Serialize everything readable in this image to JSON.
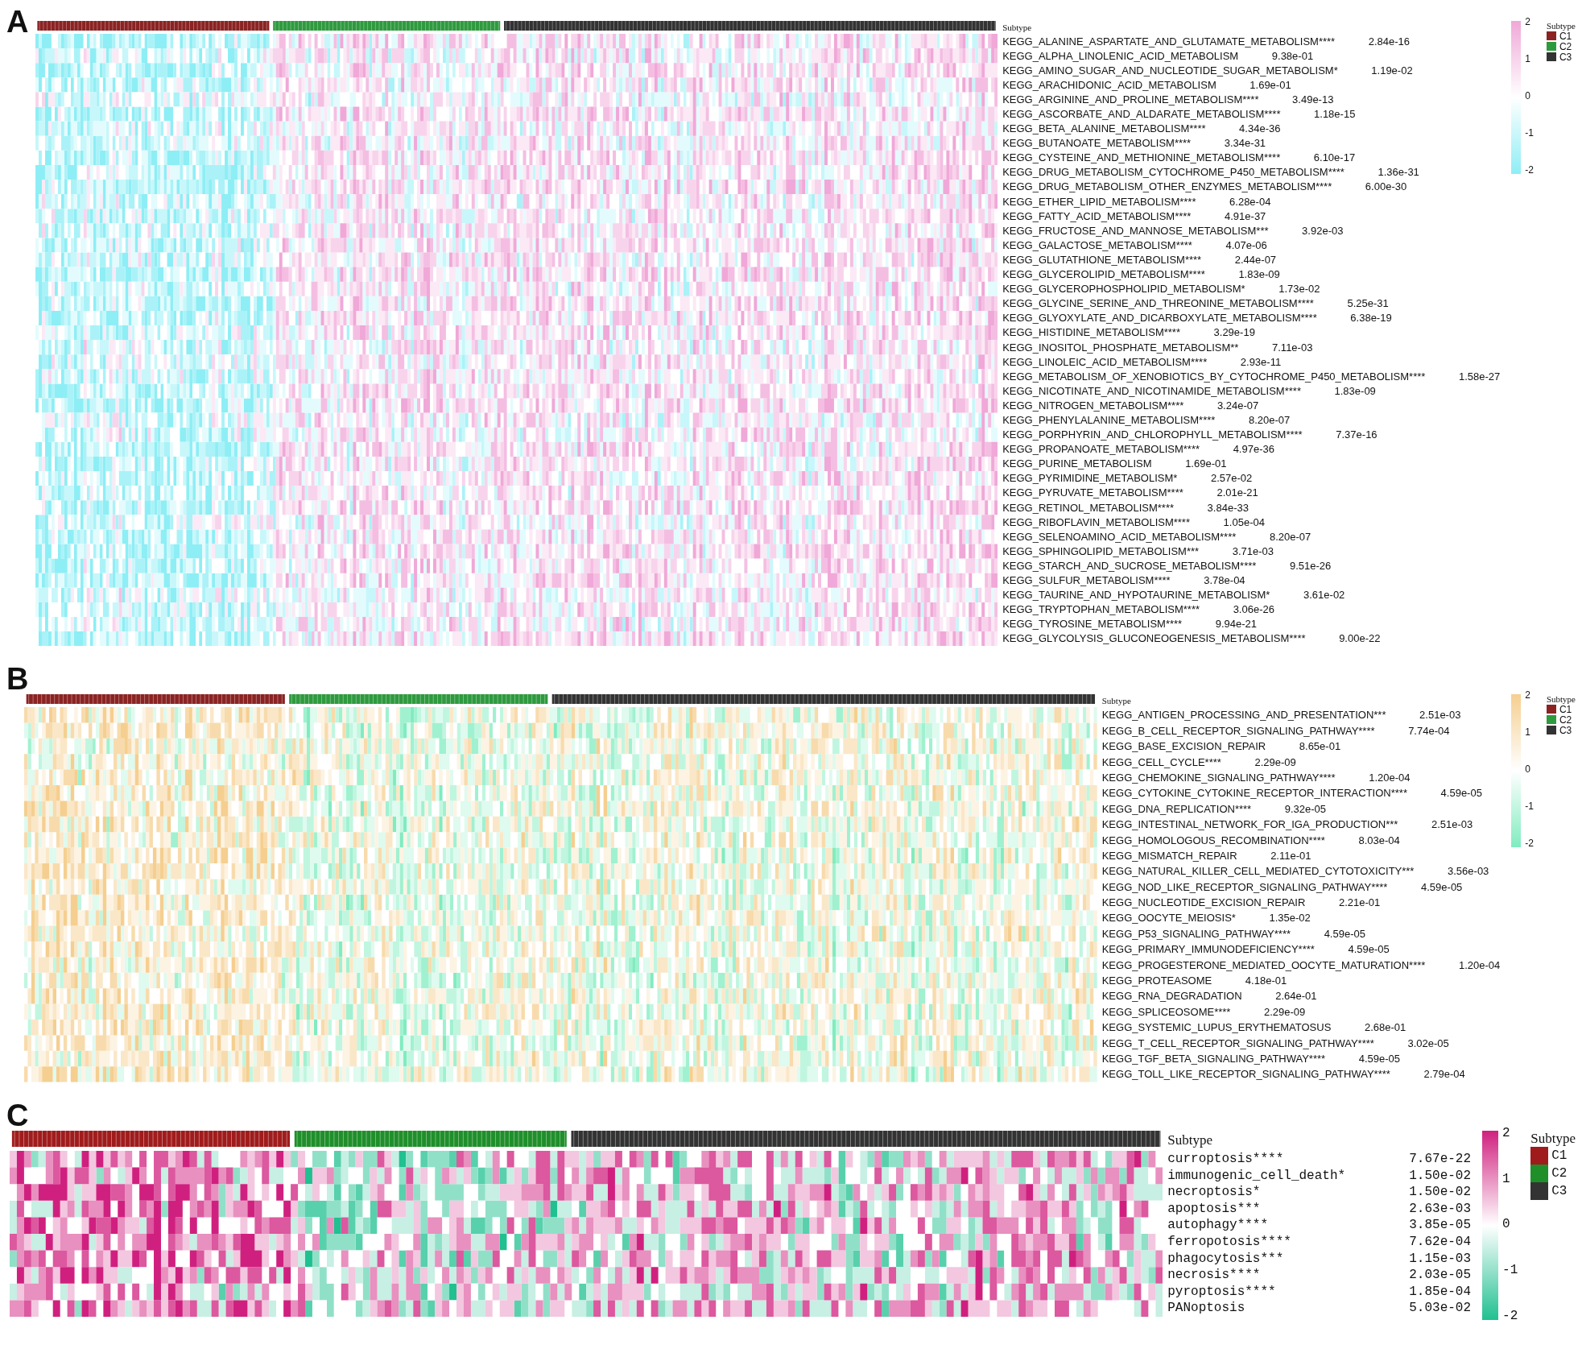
{
  "panels": [
    {
      "letter": "A",
      "annotation_label": "Subtype",
      "rows": [
        {
          "name": "KEGG_ALANINE_ASPARTATE_AND_GLUTAMATE_METABOLISM****",
          "p": "2.84e-16"
        },
        {
          "name": "KEGG_ALPHA_LINOLENIC_ACID_METABOLISM",
          "p": "9.38e-01"
        },
        {
          "name": "KEGG_AMINO_SUGAR_AND_NUCLEOTIDE_SUGAR_METABOLISM*",
          "p": "1.19e-02"
        },
        {
          "name": "KEGG_ARACHIDONIC_ACID_METABOLISM",
          "p": "1.69e-01"
        },
        {
          "name": "KEGG_ARGININE_AND_PROLINE_METABOLISM****",
          "p": "3.49e-13"
        },
        {
          "name": "KEGG_ASCORBATE_AND_ALDARATE_METABOLISM****",
          "p": "1.18e-15"
        },
        {
          "name": "KEGG_BETA_ALANINE_METABOLISM****",
          "p": "4.34e-36"
        },
        {
          "name": "KEGG_BUTANOATE_METABOLISM****",
          "p": "3.34e-31"
        },
        {
          "name": "KEGG_CYSTEINE_AND_METHIONINE_METABOLISM****",
          "p": "6.10e-17"
        },
        {
          "name": "KEGG_DRUG_METABOLISM_CYTOCHROME_P450_METABOLISM****",
          "p": "1.36e-31"
        },
        {
          "name": "KEGG_DRUG_METABOLISM_OTHER_ENZYMES_METABOLISM****",
          "p": "6.00e-30"
        },
        {
          "name": "KEGG_ETHER_LIPID_METABOLISM****",
          "p": "6.28e-04"
        },
        {
          "name": "KEGG_FATTY_ACID_METABOLISM****",
          "p": "4.91e-37"
        },
        {
          "name": "KEGG_FRUCTOSE_AND_MANNOSE_METABOLISM***",
          "p": "3.92e-03"
        },
        {
          "name": "KEGG_GALACTOSE_METABOLISM****",
          "p": "4.07e-06"
        },
        {
          "name": "KEGG_GLUTATHIONE_METABOLISM****",
          "p": "2.44e-07"
        },
        {
          "name": "KEGG_GLYCEROLIPID_METABOLISM****",
          "p": "1.83e-09"
        },
        {
          "name": "KEGG_GLYCEROPHOSPHOLIPID_METABOLISM*",
          "p": "1.73e-02"
        },
        {
          "name": "KEGG_GLYCINE_SERINE_AND_THREONINE_METABOLISM****",
          "p": "5.25e-31"
        },
        {
          "name": "KEGG_GLYOXYLATE_AND_DICARBOXYLATE_METABOLISM****",
          "p": "6.38e-19"
        },
        {
          "name": "KEGG_HISTIDINE_METABOLISM****",
          "p": "3.29e-19"
        },
        {
          "name": "KEGG_INOSITOL_PHOSPHATE_METABOLISM**",
          "p": "7.11e-03"
        },
        {
          "name": "KEGG_LINOLEIC_ACID_METABOLISM****",
          "p": "2.93e-11"
        },
        {
          "name": "KEGG_METABOLISM_OF_XENOBIOTICS_BY_CYTOCHROME_P450_METABOLISM****",
          "p": "1.58e-27"
        },
        {
          "name": "KEGG_NICOTINATE_AND_NICOTINAMIDE_METABOLISM****",
          "p": "1.83e-09"
        },
        {
          "name": "KEGG_NITROGEN_METABOLISM****",
          "p": "3.24e-07"
        },
        {
          "name": "KEGG_PHENYLALANINE_METABOLISM****",
          "p": "8.20e-07"
        },
        {
          "name": "KEGG_PORPHYRIN_AND_CHLOROPHYLL_METABOLISM****",
          "p": "7.37e-16"
        },
        {
          "name": "KEGG_PROPANOATE_METABOLISM****",
          "p": "4.97e-36"
        },
        {
          "name": "KEGG_PURINE_METABOLISM",
          "p": "1.69e-01"
        },
        {
          "name": "KEGG_PYRIMIDINE_METABOLISM*",
          "p": "2.57e-02"
        },
        {
          "name": "KEGG_PYRUVATE_METABOLISM****",
          "p": "2.01e-21"
        },
        {
          "name": "KEGG_RETINOL_METABOLISM****",
          "p": "3.84e-33"
        },
        {
          "name": "KEGG_RIBOFLAVIN_METABOLISM****",
          "p": "1.05e-04"
        },
        {
          "name": "KEGG_SELENOAMINO_ACID_METABOLISM****",
          "p": "8.20e-07"
        },
        {
          "name": "KEGG_SPHINGOLIPID_METABOLISM***",
          "p": "3.71e-03"
        },
        {
          "name": "KEGG_STARCH_AND_SUCROSE_METABOLISM****",
          "p": "9.51e-26"
        },
        {
          "name": "KEGG_SULFUR_METABOLISM****",
          "p": "3.78e-04"
        },
        {
          "name": "KEGG_TAURINE_AND_HYPOTAURINE_METABOLISM*",
          "p": "3.61e-02"
        },
        {
          "name": "KEGG_TRYPTOPHAN_METABOLISM****",
          "p": "3.06e-26"
        },
        {
          "name": "KEGG_TYROSINE_METABOLISM****",
          "p": "9.94e-21"
        },
        {
          "name": "KEGG_GLYCOLYSIS_GLUCONEOGENESIS_METABOLISM****",
          "p": "9.00e-22"
        }
      ],
      "colorbar_ticks": [
        "2",
        "1",
        "0",
        "-1",
        "-2"
      ],
      "legend": {
        "title": "Subtype",
        "items": [
          {
            "label": "C1",
            "color": "#8b2323"
          },
          {
            "label": "C2",
            "color": "#2e9a3e"
          },
          {
            "label": "C3",
            "color": "#333333"
          }
        ]
      }
    },
    {
      "letter": "B",
      "annotation_label": "Subtype",
      "rows": [
        {
          "name": "KEGG_ANTIGEN_PROCESSING_AND_PRESENTATION***",
          "p": "2.51e-03"
        },
        {
          "name": "KEGG_B_CELL_RECEPTOR_SIGNALING_PATHWAY****",
          "p": "7.74e-04"
        },
        {
          "name": "KEGG_BASE_EXCISION_REPAIR",
          "p": "8.65e-01"
        },
        {
          "name": "KEGG_CELL_CYCLE****",
          "p": "2.29e-09"
        },
        {
          "name": "KEGG_CHEMOKINE_SIGNALING_PATHWAY****",
          "p": "1.20e-04"
        },
        {
          "name": "KEGG_CYTOKINE_CYTOKINE_RECEPTOR_INTERACTION****",
          "p": "4.59e-05"
        },
        {
          "name": "KEGG_DNA_REPLICATION****",
          "p": "9.32e-05"
        },
        {
          "name": "KEGG_INTESTINAL_NETWORK_FOR_IGA_PRODUCTION***",
          "p": "2.51e-03"
        },
        {
          "name": "KEGG_HOMOLOGOUS_RECOMBINATION****",
          "p": "8.03e-04"
        },
        {
          "name": "KEGG_MISMATCH_REPAIR",
          "p": "2.11e-01"
        },
        {
          "name": "KEGG_NATURAL_KILLER_CELL_MEDIATED_CYTOTOXICITY***",
          "p": "3.56e-03"
        },
        {
          "name": "KEGG_NOD_LIKE_RECEPTOR_SIGNALING_PATHWAY****",
          "p": "4.59e-05"
        },
        {
          "name": "KEGG_NUCLEOTIDE_EXCISION_REPAIR",
          "p": "2.21e-01"
        },
        {
          "name": "KEGG_OOCYTE_MEIOSIS*",
          "p": "1.35e-02"
        },
        {
          "name": "KEGG_P53_SIGNALING_PATHWAY****",
          "p": "4.59e-05"
        },
        {
          "name": "KEGG_PRIMARY_IMMUNODEFICIENCY****",
          "p": "4.59e-05"
        },
        {
          "name": "KEGG_PROGESTERONE_MEDIATED_OOCYTE_MATURATION****",
          "p": "1.20e-04"
        },
        {
          "name": "KEGG_PROTEASOME",
          "p": "4.18e-01"
        },
        {
          "name": "KEGG_RNA_DEGRADATION",
          "p": "2.64e-01"
        },
        {
          "name": "KEGG_SPLICEOSOME****",
          "p": "2.29e-09"
        },
        {
          "name": "KEGG_SYSTEMIC_LUPUS_ERYTHEMATOSUS",
          "p": "2.68e-01"
        },
        {
          "name": "KEGG_T_CELL_RECEPTOR_SIGNALING_PATHWAY****",
          "p": "3.02e-05"
        },
        {
          "name": "KEGG_TGF_BETA_SIGNALING_PATHWAY****",
          "p": "4.59e-05"
        },
        {
          "name": "KEGG_TOLL_LIKE_RECEPTOR_SIGNALING_PATHWAY****",
          "p": "2.79e-04"
        }
      ],
      "colorbar_ticks": [
        "2",
        "1",
        "0",
        "-1",
        "-2"
      ],
      "legend": {
        "title": "Subtype",
        "items": [
          {
            "label": "C1",
            "color": "#8b2323"
          },
          {
            "label": "C2",
            "color": "#2e9a3e"
          },
          {
            "label": "C3",
            "color": "#333333"
          }
        ]
      }
    },
    {
      "letter": "C",
      "annotation_label": "Subtype",
      "rows": [
        {
          "name": "curroptosis****",
          "p": "7.67e-22"
        },
        {
          "name": "immunogenic_cell_death*",
          "p": "1.50e-02"
        },
        {
          "name": "necroptosis*",
          "p": "1.50e-02"
        },
        {
          "name": "apoptosis***",
          "p": "2.63e-03"
        },
        {
          "name": "autophagy****",
          "p": "3.85e-05"
        },
        {
          "name": "ferropotosis****",
          "p": "7.62e-04"
        },
        {
          "name": "phagocytosis***",
          "p": "1.15e-03"
        },
        {
          "name": "necrosis****",
          "p": "2.03e-05"
        },
        {
          "name": "pyroptosis****",
          "p": "1.85e-04"
        },
        {
          "name": "PANoptosis",
          "p": "5.03e-02"
        }
      ],
      "colorbar_ticks": [
        "2",
        "1",
        "0",
        "-1",
        "-2"
      ],
      "legend": {
        "title": "Subtype",
        "items": [
          {
            "label": "C1",
            "color": "#a01c1c"
          },
          {
            "label": "C2",
            "color": "#1f8f2a"
          },
          {
            "label": "C3",
            "color": "#333333"
          }
        ]
      }
    }
  ]
}
